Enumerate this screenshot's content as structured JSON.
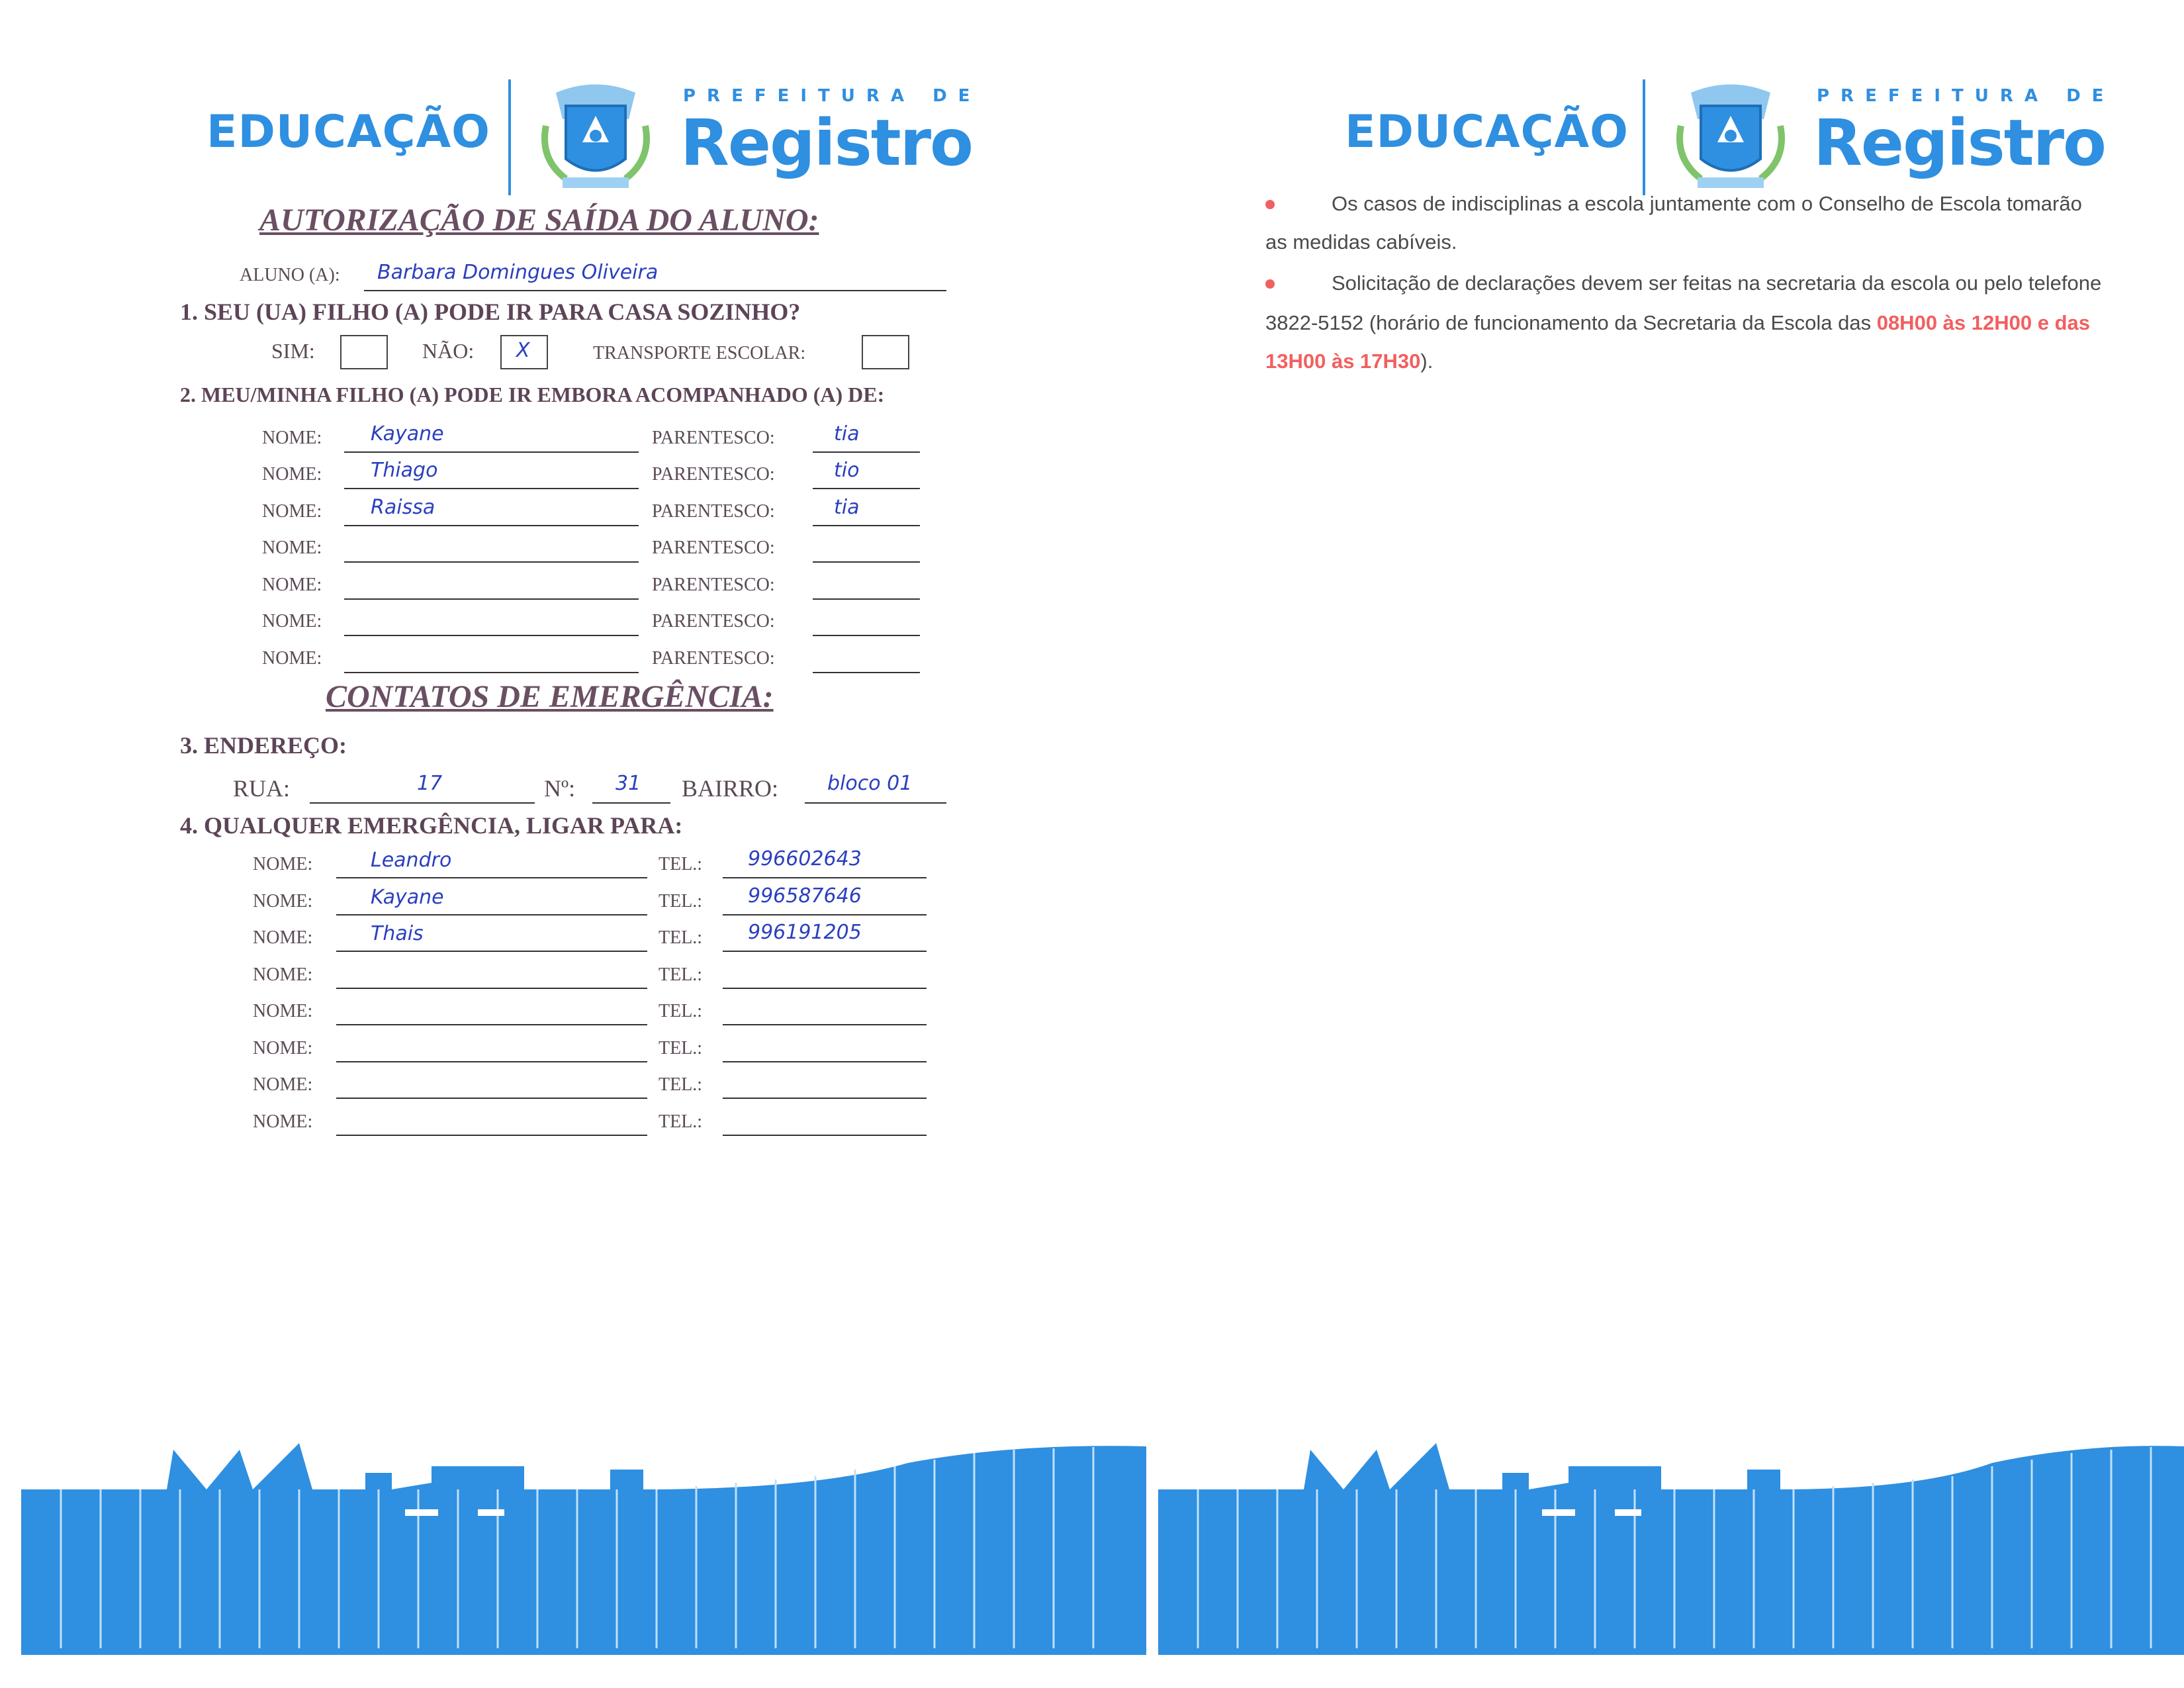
{
  "header": {
    "edu": "EDUCAÇÃO",
    "prefeitura": "PREFEITURA DE",
    "city": "Registro"
  },
  "form": {
    "title": "AUTORIZAÇÃO DE SAÍDA DO ALUNO:",
    "aluno_label": "ALUNO (A):",
    "aluno_value": "Barbara Domingues Oliveira",
    "q1": "1. SEU (UA) FILHO (A) PODE IR PARA CASA SOZINHO?",
    "sim_label": "SIM:",
    "nao_label": "NÃO:",
    "nao_mark": "X",
    "transporte_label": "TRANSPORTE ESCOLAR:",
    "q2": "2. MEU/MINHA FILHO (A) PODE IR EMBORA ACOMPANHADO (A) DE:",
    "nome_label": "NOME:",
    "parentesco_label": "PARENTESCO:",
    "companions": [
      {
        "nome": "Kayane",
        "parentesco": "tia"
      },
      {
        "nome": "Thiago",
        "parentesco": "tio"
      },
      {
        "nome": "Raissa",
        "parentesco": "tia"
      },
      {
        "nome": "",
        "parentesco": ""
      },
      {
        "nome": "",
        "parentesco": ""
      },
      {
        "nome": "",
        "parentesco": ""
      },
      {
        "nome": "",
        "parentesco": ""
      }
    ],
    "contacts_title": "CONTATOS DE EMERGÊNCIA:",
    "q3": "3. ENDEREÇO:",
    "rua_label": "RUA:",
    "rua_value": "17",
    "num_label": "Nº:",
    "num_value": "31",
    "bairro_label": "BAIRRO:",
    "bairro_value": "bloco 01",
    "q4": "4. QUALQUER EMERGÊNCIA, LIGAR PARA:",
    "tel_label": "TEL.:",
    "contacts": [
      {
        "nome": "Leandro",
        "tel": "996602643"
      },
      {
        "nome": "Kayane",
        "tel": "996587646"
      },
      {
        "nome": "Thais",
        "tel": "996191205"
      },
      {
        "nome": "",
        "tel": ""
      },
      {
        "nome": "",
        "tel": ""
      },
      {
        "nome": "",
        "tel": ""
      },
      {
        "nome": "",
        "tel": ""
      },
      {
        "nome": "",
        "tel": ""
      }
    ]
  },
  "right": {
    "line1": "Os casos de indisciplinas a escola juntamente com o Conselho de Escola tomarão",
    "line2": "as medidas cabíveis.",
    "line3": "Solicitação de declarações devem ser feitas na secretaria da escola ou pelo telefone",
    "line4_a": "3822-5152 (horário de funcionamento da Secretaria da Escola das ",
    "line4_b": "08H00 às 12H00 e das",
    "line5_a": "13H00 às 17H30",
    "line5_b": ")."
  },
  "colors": {
    "brand_blue": "#2f8fe0",
    "ink_blue": "#2a3fbf",
    "title": "#6a4f63",
    "accent_red": "#f25f5f"
  }
}
